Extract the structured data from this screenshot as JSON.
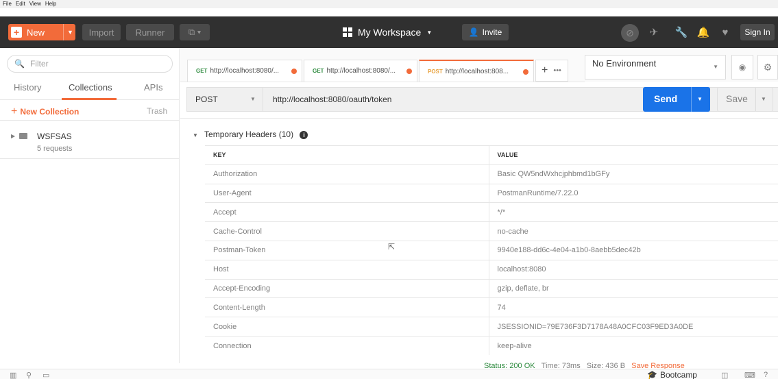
{
  "menu": [
    "File",
    "Edit",
    "View",
    "Help"
  ],
  "header": {
    "new_label": "New",
    "import_label": "Import",
    "runner_label": "Runner",
    "workspace_label": "My Workspace",
    "invite_label": "Invite",
    "signin_label": "Sign In",
    "accent": "#f26b3a"
  },
  "sidebar": {
    "filter_placeholder": "Filter",
    "tabs": [
      "History",
      "Collections",
      "APIs"
    ],
    "active_tab": "Collections",
    "new_collection": "New Collection",
    "trash": "Trash",
    "collection": {
      "name": "WSFSAS",
      "count": "5 requests"
    }
  },
  "tabs": [
    {
      "method": "GET",
      "url": "http://localhost:8080/..."
    },
    {
      "method": "GET",
      "url": "http://localhost:8080/..."
    },
    {
      "method": "POST",
      "url": "http://localhost:808..."
    }
  ],
  "environment": {
    "selected": "No Environment"
  },
  "request": {
    "method": "POST",
    "url": "http://localhost:8080/oauth/token",
    "send_label": "Send",
    "save_label": "Save"
  },
  "headers_panel": {
    "title": "Temporary Headers (10)",
    "col_key": "KEY",
    "col_value": "VALUE",
    "rows": [
      {
        "key": "Authorization",
        "value": "Basic QW5ndWxhcjphbmd1bGFy"
      },
      {
        "key": "User-Agent",
        "value": "PostmanRuntime/7.22.0"
      },
      {
        "key": "Accept",
        "value": "*/*"
      },
      {
        "key": "Cache-Control",
        "value": "no-cache"
      },
      {
        "key": "Postman-Token",
        "value": "9940e188-dd6c-4e04-a1b0-8aebb5dec42b"
      },
      {
        "key": "Host",
        "value": "localhost:8080"
      },
      {
        "key": "Accept-Encoding",
        "value": "gzip, deflate, br"
      },
      {
        "key": "Content-Length",
        "value": "74"
      },
      {
        "key": "Cookie",
        "value": "JSESSIONID=79E736F3D7178A48A0CFC03F9ED3A0DE"
      },
      {
        "key": "Connection",
        "value": "keep-alive"
      }
    ]
  },
  "response_status": {
    "status": "Status: 200 OK",
    "time": "Time: 73ms",
    "size": "Size: 436 B",
    "save_response": "Save Response"
  },
  "footer": {
    "bootcamp": "Bootcamp"
  }
}
